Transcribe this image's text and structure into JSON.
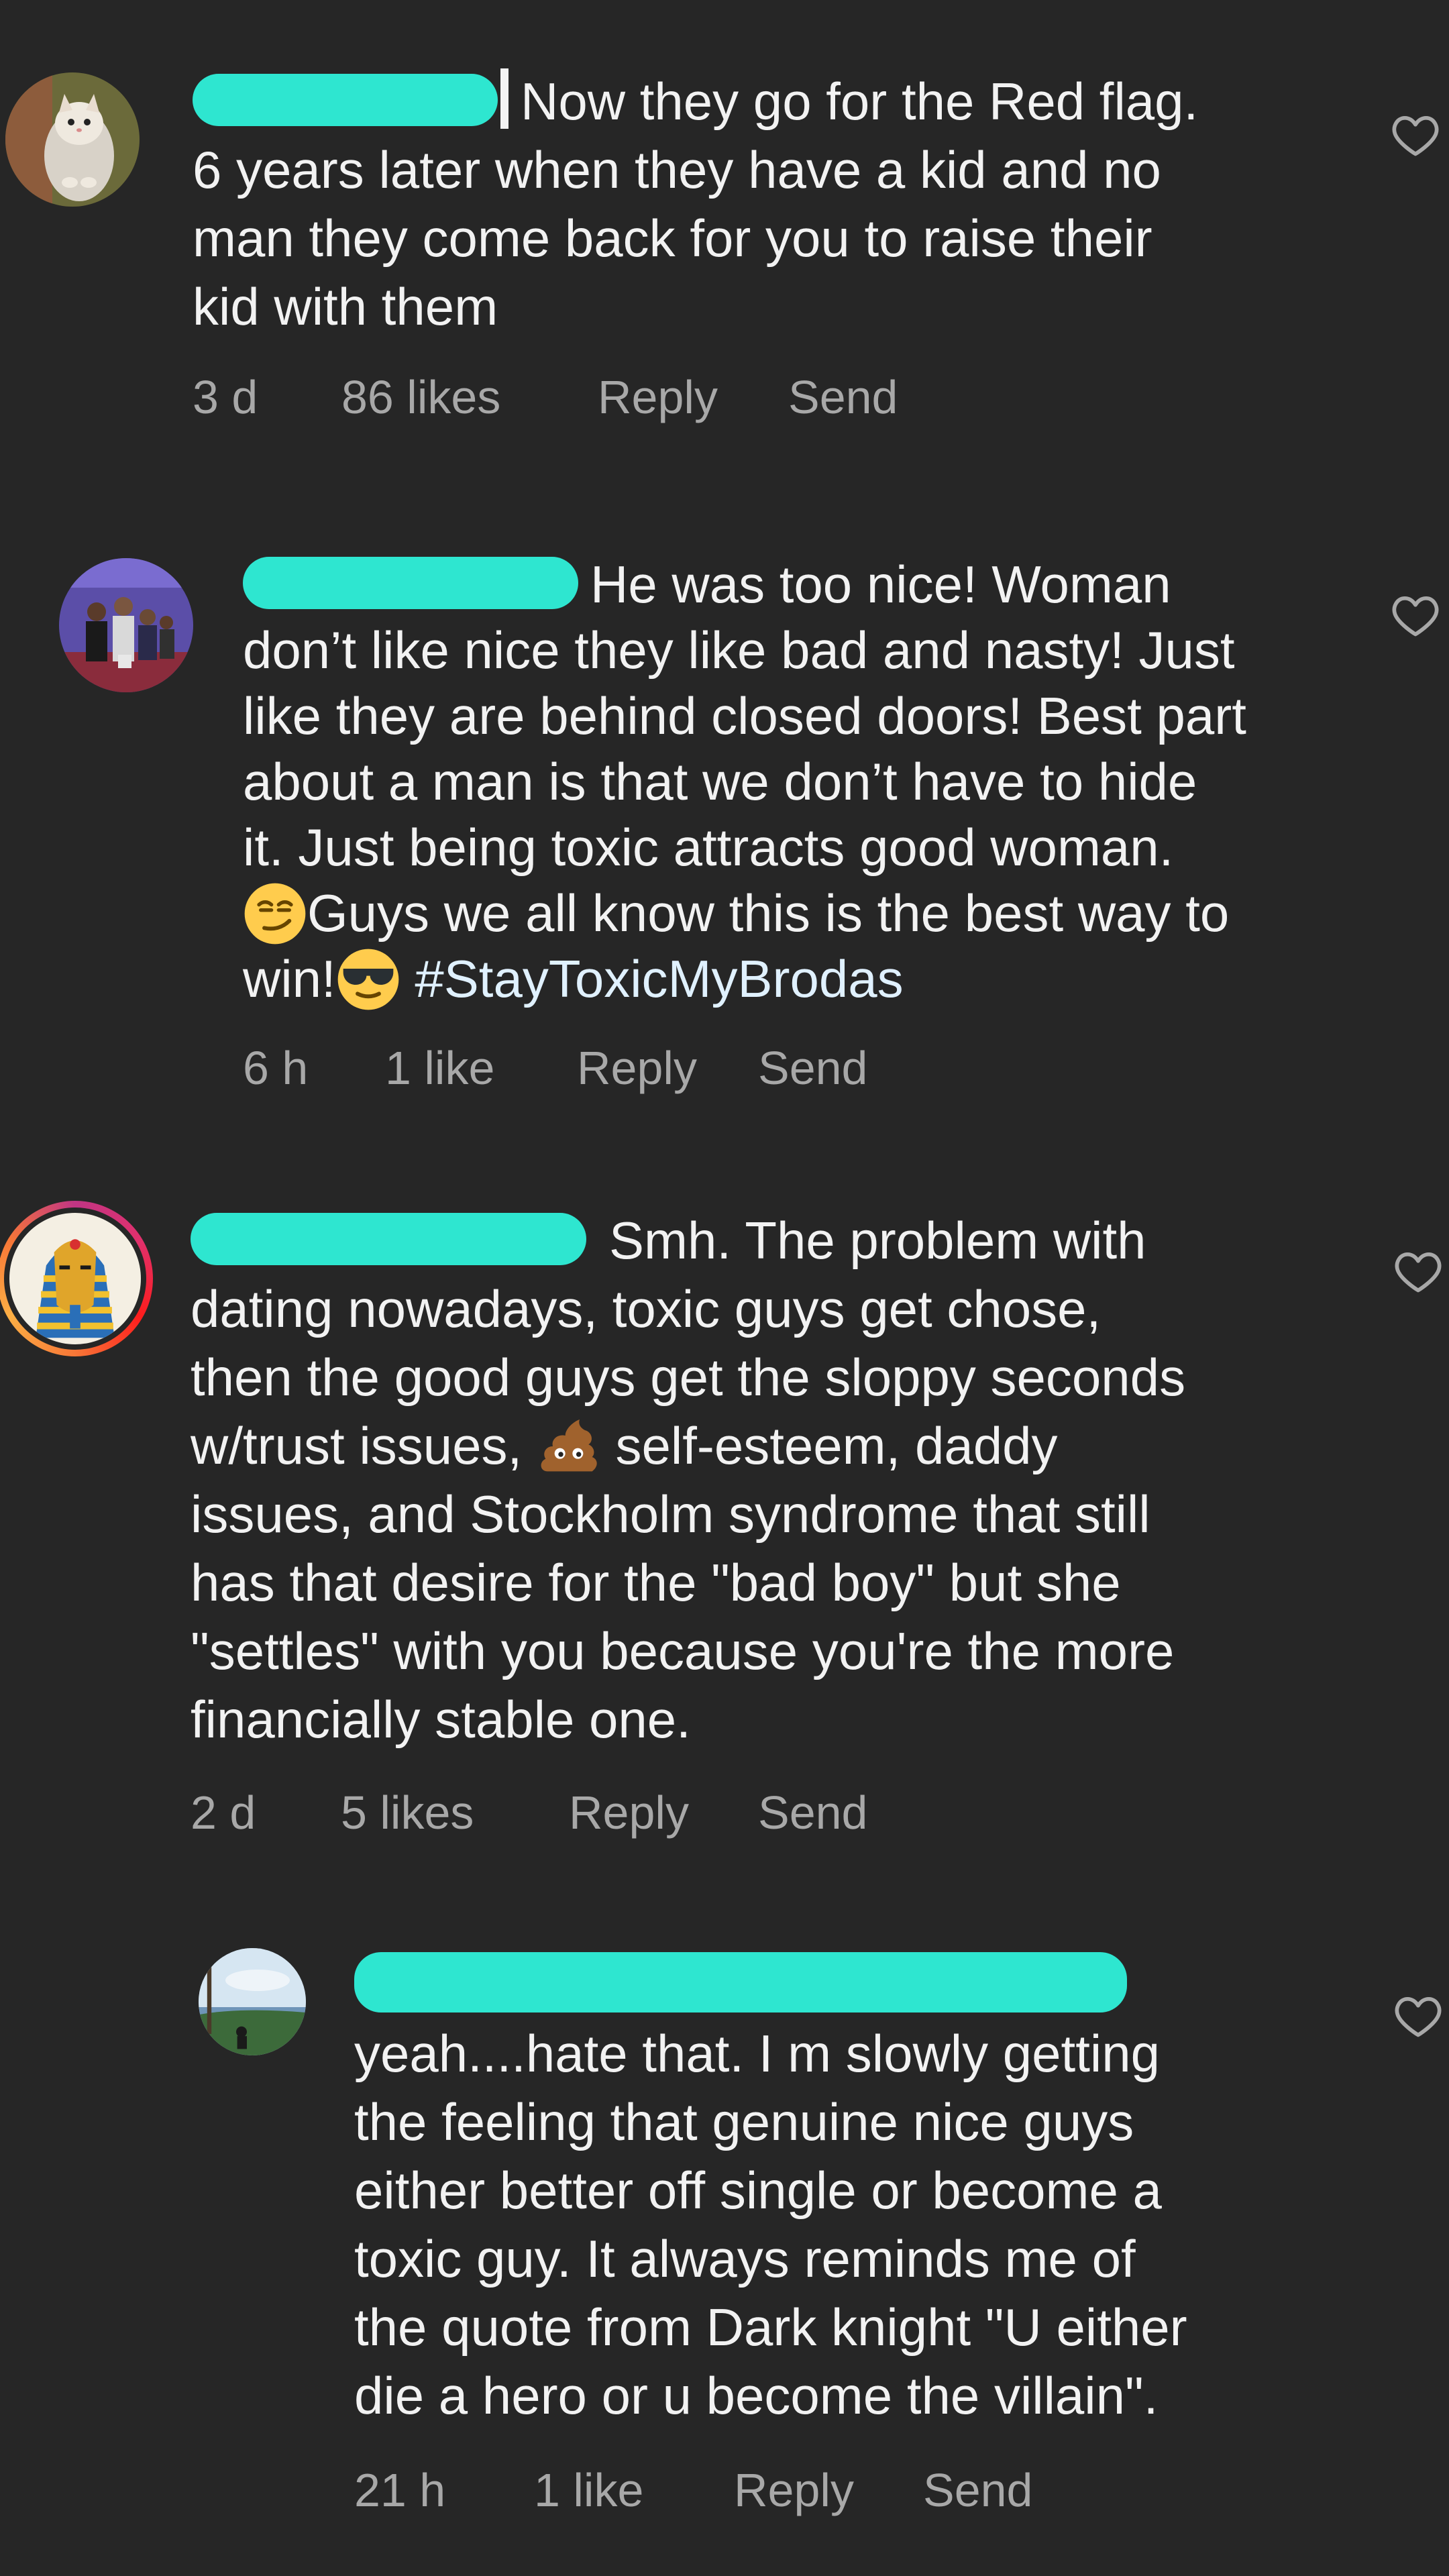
{
  "comments": [
    {
      "text_line1": "Now they go for the Red flag.",
      "text_rest": "6 years later when they have a kid and no\nman they come back for you to raise their\nkid with them",
      "time": "3 d",
      "likes": "86 likes",
      "reply": "Reply",
      "send": "Send"
    },
    {
      "text_line1": "He was too nice! Woman",
      "text_rest": "don’t like nice they like bad and nasty! Just\nlike they are behind closed doors! Best part\nabout a man is that we don’t have to hide\nit. Just being toxic attracts good woman.",
      "text_emoji_line": "Guys we all know this is the best way to",
      "text_win": "win!",
      "hashtag": "#StayToxicMyBrodas",
      "time": "6 h",
      "likes": "1 like",
      "reply": "Reply",
      "send": "Send"
    },
    {
      "text_line1": "Smh. The problem with",
      "text_rest": "dating nowadays, toxic guys get chose,\nthen the good guys get the sloppy seconds",
      "text_emoji_pre": "w/trust issues, ",
      "text_emoji_post": " self-esteem, daddy",
      "text_tail": "issues, and Stockholm syndrome that still\nhas that desire for the \"bad boy\" but she\n\"settles\" with you because you're the more\nfinancially stable one.",
      "time": "2 d",
      "likes": "5 likes",
      "reply": "Reply",
      "send": "Send"
    },
    {
      "text": "yeah....hate that. I m slowly getting\nthe feeling that genuine nice guys\neither better off single or become a\ntoxic guy. It always reminds me of\nthe quote from Dark knight \"U either\ndie a hero or u become the villain\".",
      "time": "21 h",
      "likes": "1 like",
      "reply": "Reply",
      "send": "Send"
    }
  ],
  "icons": {
    "heart": "heart-outline-icon",
    "smirk": "smirking-face-emoji",
    "sunglasses": "sunglasses-face-emoji",
    "poop": "pile-of-poo-emoji"
  },
  "colors": {
    "background": "#262626",
    "text": "#f2f2f2",
    "meta": "#a8a8a8",
    "redaction": "#2ee6d0"
  }
}
